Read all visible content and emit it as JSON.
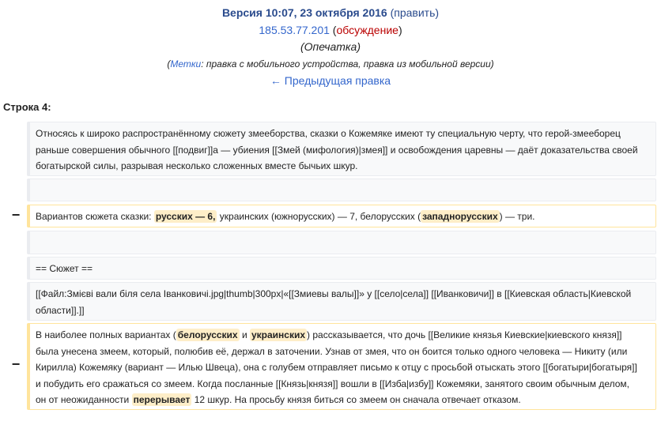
{
  "header": {
    "version_title": "Версия 10:07, 23 октября 2016",
    "edit_link_open": " (",
    "edit_link": "править",
    "edit_link_close": ")",
    "ip_address": "185.53.77.201",
    "talk_open": " (",
    "talk_link": "обсуждение",
    "talk_close": ")",
    "summary": "(Опечатка)",
    "tags_open": "(",
    "tags_label": "Метки",
    "tags_text": ": правка с мобильного устройства, правка из мобильной версии)",
    "prev_link": "← Предыдущая правка"
  },
  "diff": {
    "line_label": "Строка 4:",
    "marker": "−",
    "context1": {
      "l1": "Относясь к широко распространённому сюжету змееборства, сказки о Кожемяке имеют ту специальную черту, что герой-змееборец",
      "l2": "раньше совершения обычного [[подвиг]]а — убиения [[Змей (мифология)|змея]] и освобождения царевны — даёт доказательства своей",
      "l3": "богатырской силы, разрывая несколько сложенных вместе бычьих шкур."
    },
    "deleted1": {
      "p1": "Вариантов сюжета сказки: ",
      "h1": "русских — 6,",
      "p2": " украинских (южнорусских) — 7, белорусских (",
      "h2": "западнорусских",
      "p3": ") — три."
    },
    "heading_line": "== Сюжет ==",
    "file_line": {
      "l1": "[[Файл:Змієві вали біля села Іванковичі.jpg|thumb|300px|«[[Змиевы валы]]» у [[село|села]] [[Иванковичи]] в [[Киевская область|Киевской",
      "l2": "области]].]]"
    },
    "deleted2": {
      "a1": "В наиболее полных вариантах (",
      "a2": "белорусских",
      "a3": " и ",
      "a4": "украинских",
      "a5": ") рассказывается, что дочь [[Великие князья Киевские|киевского князя]]",
      "b": "была унесена змеем, который, полюбив её, держал в заточении. Узнав от змея, что он боится только одного человека — Никиту (или",
      "c": "Кирилла) Кожемяку (вариант — Илью Швеца), она с голубем отправляет письмо к отцу с просьбой отыскать этого [[богатыри|богатыря]]",
      "d": "и побудить его сражаться со змеем. Когда посланные [[Князь|князя]] вошли в [[Изба|избу]] Кожемяки, занятого своим обычным делом,",
      "e1": "он от неожиданности ",
      "e2": "перерывает",
      "e3": " 12 шкур. На просьбу князя биться со змеем он сначала отвечает отказом."
    }
  }
}
